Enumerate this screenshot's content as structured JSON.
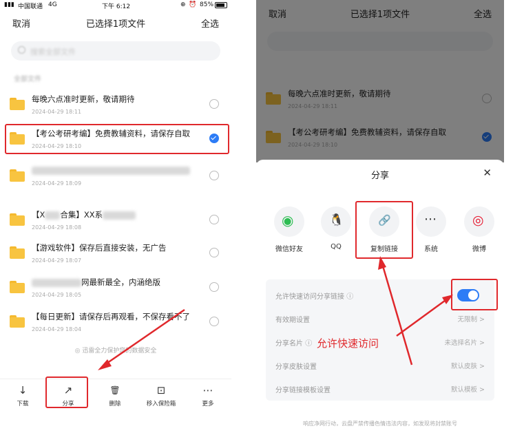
{
  "left": {
    "status": {
      "carrier": "中国联通",
      "network": "4G",
      "time": "下午 6:12",
      "battery": "85%"
    },
    "header": {
      "cancel": "取消",
      "title": "已选择1项文件",
      "select_all": "全选"
    },
    "search_placeholder": "搜索全部文件",
    "breadcrumb": "全部文件",
    "files": [
      {
        "name": "每晚六点准时更新，敬请期待",
        "date": "2024-04-29 18:11",
        "selected": false
      },
      {
        "name": "【考公考研考编】免费教辅资料，请保存自取",
        "date": "2024-04-29 18:10",
        "selected": true
      },
      {
        "name": "",
        "date": "2024-04-29 18:09",
        "selected": false
      },
      {
        "name_prefix": "【X",
        "name_mid": "合集】XX系",
        "date": "2024-04-29 18:08",
        "selected": false
      },
      {
        "name": "【游戏软件】保存后直接安装，无广告",
        "date": "2024-04-29 18:07",
        "selected": false
      },
      {
        "name_suffix": "网最新最全，内涵绝版",
        "date": "2024-04-29 18:05",
        "selected": false
      },
      {
        "name": "【每日更新】请保存后再观看，不保存看不了",
        "date": "2024-04-29 18:04",
        "selected": false
      }
    ],
    "footer_note": "迅雷全力保护您的数据安全",
    "toolbar": [
      {
        "label": "下载",
        "icon": "download-icon",
        "glyph": "↓"
      },
      {
        "label": "分享",
        "icon": "share-icon",
        "glyph": "↗"
      },
      {
        "label": "删除",
        "icon": "trash-icon",
        "glyph": "🗑"
      },
      {
        "label": "移入保险箱",
        "icon": "safe-icon",
        "glyph": "⊡"
      },
      {
        "label": "更多",
        "icon": "more-icon",
        "glyph": "⋯"
      }
    ]
  },
  "right": {
    "header": {
      "cancel": "取消",
      "title": "已选择1项文件",
      "select_all": "全选"
    },
    "files": [
      {
        "name": "每晚六点准时更新，敬请期待",
        "date": "2024-04-29 18:11"
      },
      {
        "name": "【考公考研考编】免费教辅资料，请保存自取",
        "date": "2024-04-29 18:10"
      }
    ],
    "share": {
      "title": "分享",
      "close_glyph": "✕",
      "options": [
        {
          "label": "微信好友",
          "icon": "wechat-icon",
          "glyph": "◉"
        },
        {
          "label": "QQ",
          "icon": "qq-icon",
          "glyph": "🐧"
        },
        {
          "label": "复制链接",
          "icon": "link-icon",
          "glyph": "🔗"
        },
        {
          "label": "系统",
          "icon": "system-icon",
          "glyph": "⋯"
        },
        {
          "label": "微博",
          "icon": "weibo-icon",
          "glyph": "◎"
        }
      ],
      "settings": [
        {
          "label": "允许快速访问分享链接",
          "value": ""
        },
        {
          "label": "有效期设置",
          "value": "无限制 >"
        },
        {
          "label": "分享名片",
          "value": "未选择名片 >"
        },
        {
          "label": "分享皮肤设置",
          "value": "默认皮肤 >"
        },
        {
          "label": "分享链接模板设置",
          "value": "默认模板 >"
        }
      ],
      "quick_access_enabled": true,
      "annotation": "允许快速访问",
      "footer": "响应净网行动，云盘严禁传播色情违法内容，如发现将封禁账号"
    },
    "colors": {
      "accent": "#2d7cf6",
      "annotation_red": "#e0282c"
    }
  }
}
